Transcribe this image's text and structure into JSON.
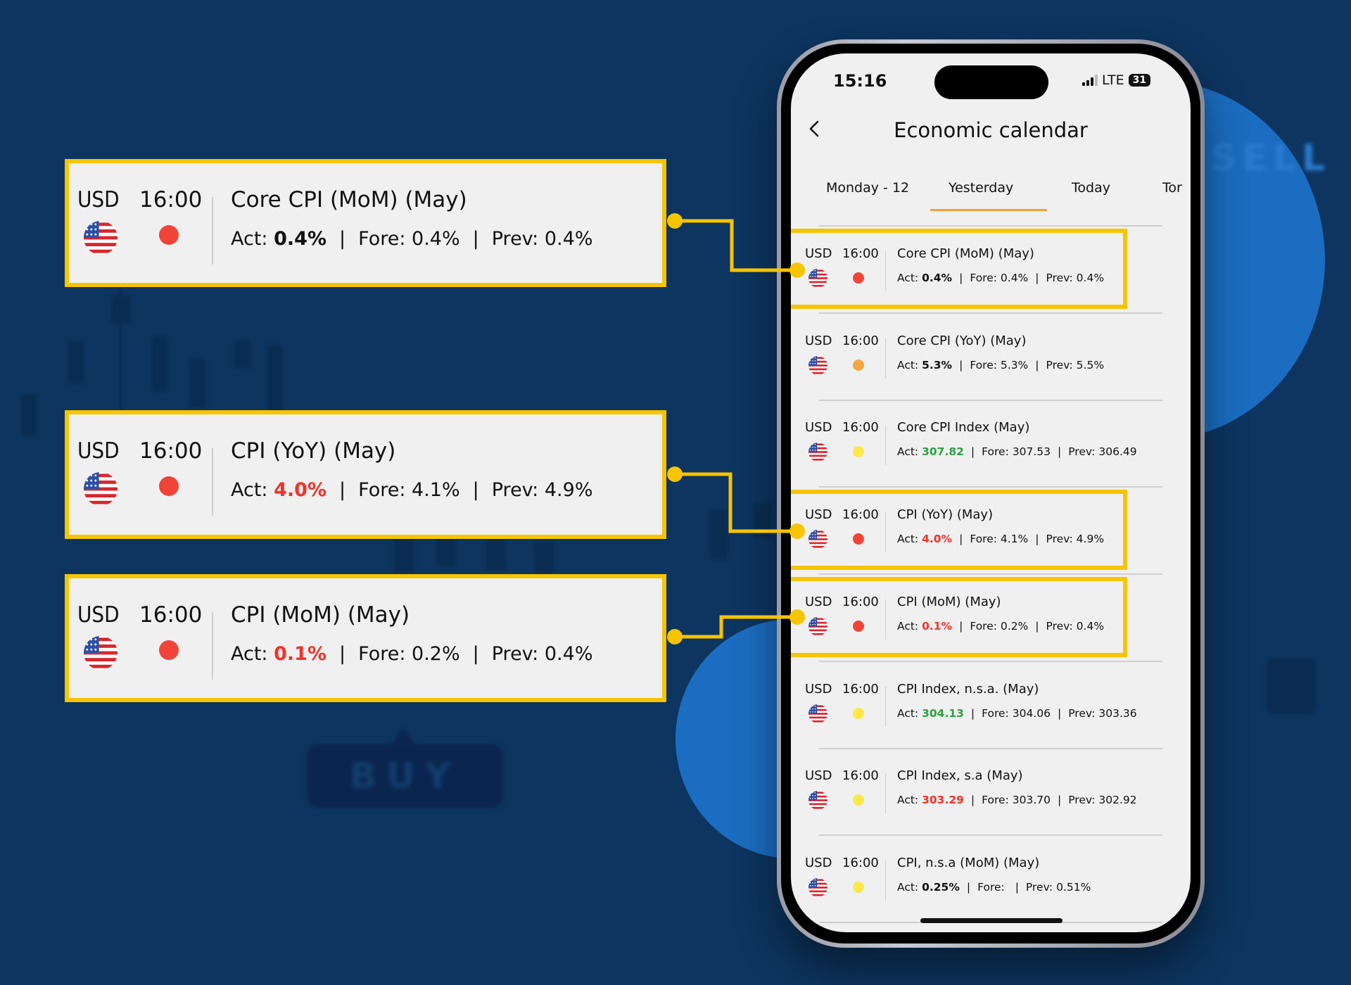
{
  "background": {
    "buy_label": "BUY",
    "sell_label": "SELL",
    "colors": {
      "background": "#0d3560",
      "accent_circle": "#1b6dc1",
      "highlight": "#f7c400"
    }
  },
  "status_bar": {
    "time": "15:16",
    "network": "LTE",
    "battery": "31"
  },
  "header": {
    "title": "Economic calendar",
    "back_icon": "chevron-left-icon"
  },
  "tabs": [
    {
      "label": "Monday - 12",
      "active": false
    },
    {
      "label": "Yesterday",
      "active": true
    },
    {
      "label": "Today",
      "active": false
    },
    {
      "label": "Tor",
      "active": false
    }
  ],
  "colors": {
    "impact_high": "#f04438",
    "impact_medium": "#f7a740",
    "impact_low": "#fde84a",
    "value_negative": "#f0332a",
    "value_positive": "#2ea043",
    "value_neutral": "#111111"
  },
  "events": [
    {
      "currency": "USD",
      "time": "16:00",
      "name": "Core CPI (MoM) (May)",
      "impact": "high",
      "act_label": "Act:",
      "act": "0.4%",
      "act_tone": "neutral",
      "fore_label": "Fore:",
      "fore": "0.4%",
      "prev_label": "Prev:",
      "prev": "0.4%",
      "highlighted": true
    },
    {
      "currency": "USD",
      "time": "16:00",
      "name": "Core CPI (YoY) (May)",
      "impact": "medium",
      "act_label": "Act:",
      "act": "5.3%",
      "act_tone": "neutral",
      "fore_label": "Fore:",
      "fore": "5.3%",
      "prev_label": "Prev:",
      "prev": "5.5%",
      "highlighted": false
    },
    {
      "currency": "USD",
      "time": "16:00",
      "name": "Core CPI Index (May)",
      "impact": "low",
      "act_label": "Act:",
      "act": "307.82",
      "act_tone": "positive",
      "fore_label": "Fore:",
      "fore": "307.53",
      "prev_label": "Prev:",
      "prev": "306.49",
      "highlighted": false
    },
    {
      "currency": "USD",
      "time": "16:00",
      "name": "CPI (YoY) (May)",
      "impact": "high",
      "act_label": "Act:",
      "act": "4.0%",
      "act_tone": "negative",
      "fore_label": "Fore:",
      "fore": "4.1%",
      "prev_label": "Prev:",
      "prev": "4.9%",
      "highlighted": true
    },
    {
      "currency": "USD",
      "time": "16:00",
      "name": "CPI (MoM) (May)",
      "impact": "high",
      "act_label": "Act:",
      "act": "0.1%",
      "act_tone": "negative",
      "fore_label": "Fore:",
      "fore": "0.2%",
      "prev_label": "Prev:",
      "prev": "0.4%",
      "highlighted": true
    },
    {
      "currency": "USD",
      "time": "16:00",
      "name": "CPI Index, n.s.a. (May)",
      "impact": "low",
      "act_label": "Act:",
      "act": "304.13",
      "act_tone": "positive",
      "fore_label": "Fore:",
      "fore": "304.06",
      "prev_label": "Prev:",
      "prev": "303.36",
      "highlighted": false
    },
    {
      "currency": "USD",
      "time": "16:00",
      "name": "CPI Index, s.a (May)",
      "impact": "low",
      "act_label": "Act:",
      "act": "303.29",
      "act_tone": "negative",
      "fore_label": "Fore:",
      "fore": "303.70",
      "prev_label": "Prev:",
      "prev": "302.92",
      "highlighted": false
    },
    {
      "currency": "USD",
      "time": "16:00",
      "name": "CPI, n.s.a (MoM) (May)",
      "impact": "low",
      "act_label": "Act:",
      "act": "0.25%",
      "act_tone": "neutral",
      "fore_label": "Fore:",
      "fore": "",
      "prev_label": "Prev:",
      "prev": "0.51%",
      "highlighted": false
    }
  ],
  "callouts": [
    {
      "currency": "USD",
      "time": "16:00",
      "name": "Core CPI (MoM) (May)",
      "impact": "high",
      "act_label": "Act:",
      "act": "0.4%",
      "act_tone": "neutral",
      "fore_label": "Fore:",
      "fore": "0.4%",
      "prev_label": "Prev:",
      "prev": "0.4%",
      "links_to_event": 0
    },
    {
      "currency": "USD",
      "time": "16:00",
      "name": "CPI (YoY) (May)",
      "impact": "high",
      "act_label": "Act:",
      "act": "4.0%",
      "act_tone": "negative",
      "fore_label": "Fore:",
      "fore": "4.1%",
      "prev_label": "Prev:",
      "prev": "4.9%",
      "links_to_event": 3
    },
    {
      "currency": "USD",
      "time": "16:00",
      "name": "CPI (MoM) (May)",
      "impact": "high",
      "act_label": "Act:",
      "act": "0.1%",
      "act_tone": "negative",
      "fore_label": "Fore:",
      "fore": "0.2%",
      "prev_label": "Prev:",
      "prev": "0.4%",
      "links_to_event": 4
    }
  ]
}
